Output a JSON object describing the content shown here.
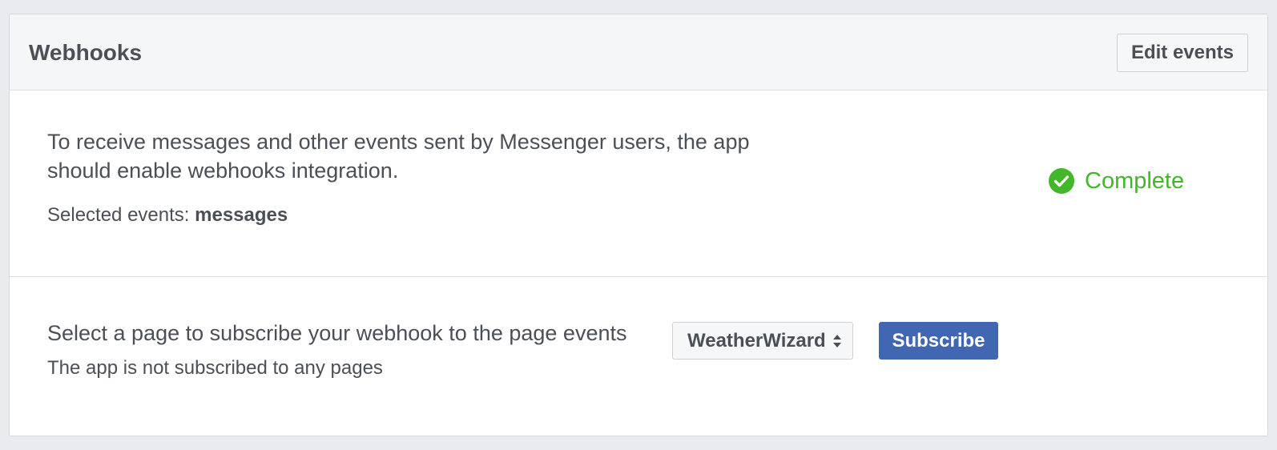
{
  "card": {
    "title": "Webhooks",
    "edit_button": "Edit events"
  },
  "integration": {
    "description": "To receive messages and other events sent by Messenger users, the app should enable webhooks integration.",
    "selected_events_label": "Selected events:",
    "selected_events_value": "messages",
    "status_text": "Complete",
    "status_icon": "check-circle-icon",
    "status_color": "#42b72a"
  },
  "subscription": {
    "label": "Select a page to subscribe your webhook to the page events",
    "status": "The app is not subscribed to any pages",
    "selected_page": "WeatherWizard",
    "select_icon": "updown-arrows-icon",
    "subscribe_button": "Subscribe",
    "button_color": "#4267b2"
  }
}
